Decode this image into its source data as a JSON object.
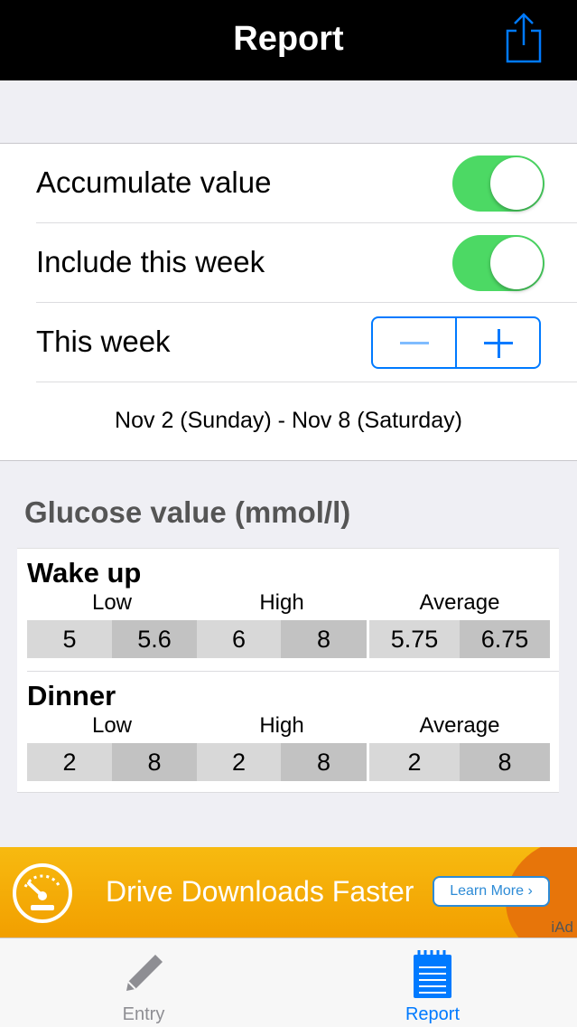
{
  "nav": {
    "title": "Report",
    "share_icon": "share-icon"
  },
  "settings": {
    "accumulate": {
      "label": "Accumulate value",
      "on": true
    },
    "include_week": {
      "label": "Include this week",
      "on": true
    },
    "week": {
      "label": "This week",
      "minus_icon": "minus-icon",
      "plus_icon": "plus-icon"
    },
    "date_range": "Nov 2 (Sunday) - Nov 8 (Saturday)"
  },
  "glucose": {
    "title": "Glucose value (mmol/l)",
    "columns": [
      "Low",
      "High",
      "Average"
    ],
    "groups": [
      {
        "name": "Wake up",
        "values": [
          "5",
          "5.6",
          "6",
          "8",
          "5.75",
          "6.75"
        ]
      },
      {
        "name": "Dinner",
        "values": [
          "2",
          "8",
          "2",
          "8",
          "2",
          "8"
        ]
      }
    ]
  },
  "ad": {
    "headline": "Drive Downloads Faster",
    "cta": "Learn More ›",
    "tag": "iAd",
    "icon": "speedometer-icon"
  },
  "tabs": [
    {
      "label": "Entry",
      "icon": "pencil-icon",
      "active": false,
      "color": "#8e8e93"
    },
    {
      "label": "Report",
      "icon": "notepad-icon",
      "active": true,
      "color": "#007aff"
    }
  ],
  "colors": {
    "accent": "#007aff",
    "toggle_on": "#4cd964",
    "ad_orange": "#f29f00"
  }
}
